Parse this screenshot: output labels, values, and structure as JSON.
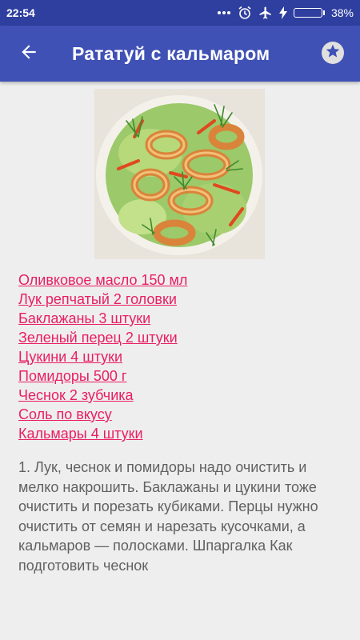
{
  "status_bar": {
    "time": "22:54",
    "battery_percent": "38%",
    "battery_level": 0.38,
    "icons": [
      "dots-icon",
      "alarm-icon",
      "airplane-mode-icon",
      "charging-icon",
      "battery-icon"
    ]
  },
  "app_bar": {
    "title": "Рататуй с кальмаром",
    "back_icon": "arrow-back-icon",
    "favorite_icon": "star-icon"
  },
  "image": {
    "subject": "squid-ratatouille-dish"
  },
  "ingredients": [
    "Оливковое масло 150 мл",
    "Лук репчатый 2 головки",
    "Баклажаны 3 штуки",
    "Зеленый перец 2 штуки",
    "Цукини 4 штуки",
    "Помидоры 500 г",
    "Чеснок 2 зубчика",
    "Соль по вкусу",
    "Кальмары 4 штуки"
  ],
  "instructions": "1. Лук, чеснок и помидоры надо очистить и мелко накрошить. Баклажаны и цукини тоже очистить и порезать кубиками. Перцы нужно очистить от семян и нарезать кусочками, а кальмаров — полосками. Шпаргалка Как подготовить чеснок",
  "colors": {
    "status_bar": "#2f3f9f",
    "app_bar": "#3f51b5",
    "link": "#e91e63",
    "body_text": "#616161",
    "background": "#eeeeee"
  }
}
